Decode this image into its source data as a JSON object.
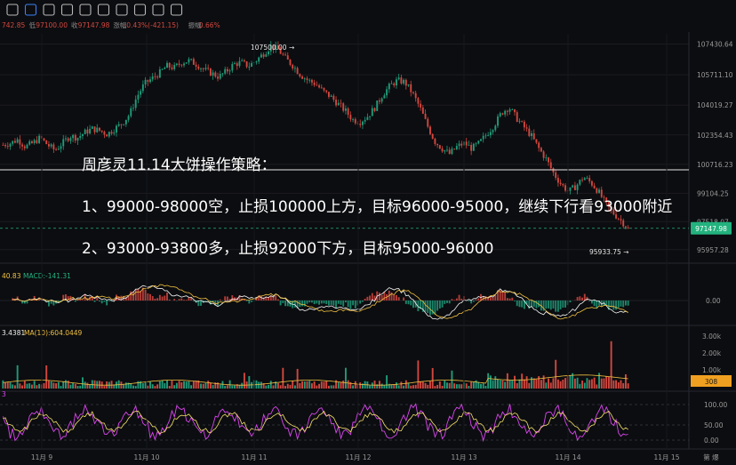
{
  "toolbar": {
    "icons": [
      "pen-icon",
      "layout-icon",
      "pencil-icon",
      "brush-icon",
      "ruler-icon",
      "lock-icon",
      "eye-icon",
      "magnet-icon",
      "filter-icon",
      "trash-icon"
    ]
  },
  "ohlc": {
    "open": "742.85",
    "low_label": "低",
    "low": "97100.00",
    "close_label": "收",
    "close": "97147.98",
    "change_label": "涨幅",
    "change": "-0.43%(-421.15)",
    "amp_label": "振幅",
    "amp": "0.66%"
  },
  "overlay": {
    "title": "周彦灵11.14大饼操作策略：",
    "line1": "1、99000-98000空，止损100000上方，目标96000-95000，继续下行看93000附近",
    "line2": "2、93000-93800多，止损92000下方，目标95000-96000"
  },
  "annotations": {
    "high": "107500.00 →",
    "low": "95933.75 →"
  },
  "price_axis": {
    "ticks": [
      "107430.64",
      "105711.10",
      "104019.27",
      "102354.43",
      "100716.23",
      "99104.25",
      "97518.07",
      "95957.28"
    ],
    "current": "97147.98"
  },
  "macd": {
    "label_prefix": "40.83",
    "label": "MACD:-141.31",
    "tick": "0.00"
  },
  "volume": {
    "label_prefix": "3.4381",
    "label": "MA(10):604.0449",
    "ticks": [
      "3.00k",
      "2.00k",
      "1.00k"
    ],
    "current": "308"
  },
  "rsi": {
    "label": "3",
    "ticks": [
      "100.00",
      "50.00",
      "0.00"
    ]
  },
  "time_axis": {
    "labels": [
      "11月 9",
      "11月 10",
      "11月 11",
      "11月 12",
      "11月 13",
      "11月 14",
      "11月 15"
    ],
    "corner": "第 爆"
  },
  "colors": {
    "up": "#1f9b7a",
    "down": "#d2473f",
    "current": "#22b27e",
    "volume_badge": "#f0a020",
    "rsi_line1": "#d946ef",
    "rsi_line2": "#f3e06a"
  },
  "chart_data": {
    "type": "candlestick",
    "title": "",
    "price_range": [
      95400,
      108000
    ],
    "x_dates": [
      "11月 9",
      "11月 10",
      "11月 11",
      "11月 12",
      "11月 13",
      "11月 14",
      "11月 15"
    ],
    "close_path": [
      101800,
      101900,
      102100,
      101700,
      101900,
      102200,
      101800,
      101500,
      101900,
      102300,
      102200,
      102500,
      102700,
      102600,
      102400,
      102700,
      103000,
      103500,
      104500,
      105200,
      105500,
      105800,
      106200,
      106100,
      106400,
      106500,
      106300,
      106000,
      105800,
      105600,
      105900,
      106300,
      106400,
      106200,
      106500,
      106900,
      107300,
      107100,
      106600,
      106200,
      105700,
      105400,
      105200,
      104800,
      104500,
      104100,
      103700,
      103200,
      103100,
      103400,
      103900,
      104600,
      105100,
      105400,
      105300,
      104700,
      103900,
      102900,
      102000,
      101600,
      101300,
      101700,
      101900,
      101600,
      101900,
      102400,
      102900,
      103600,
      103900,
      103300,
      102800,
      102300,
      101600,
      101000,
      100200,
      99600,
      99200,
      99500,
      100000,
      99700,
      99200,
      98500,
      98000,
      97600,
      97148
    ],
    "high_marker": 107500.0,
    "low_marker": 95933.75,
    "current": 97147.98
  }
}
